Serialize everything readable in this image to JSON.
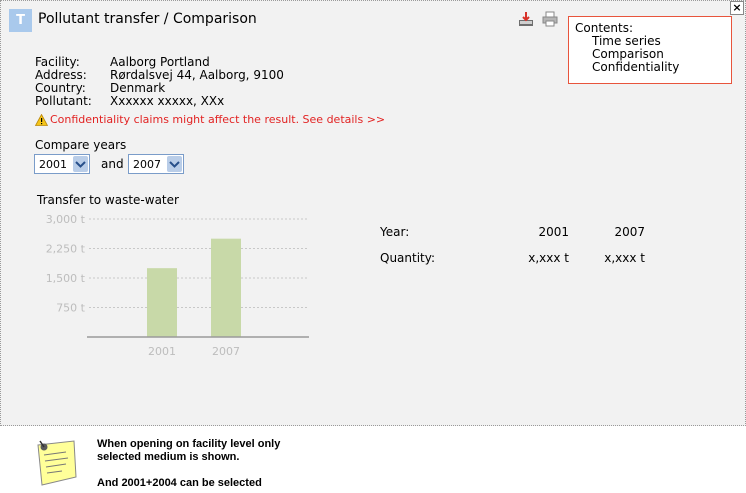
{
  "panel": {
    "badge": "T",
    "title": "Pollutant transfer / Comparison",
    "close_label": "×"
  },
  "contents": {
    "heading": "Contents:",
    "links": [
      "Time series",
      "Comparison",
      "Confidentiality"
    ]
  },
  "facility": {
    "facility_label": "Facility:",
    "facility_value": "Aalborg Portland",
    "address_label": "Address:",
    "address_value": "Rørdalsvej 44, Aalborg, 9100",
    "country_label": "Country:",
    "country_value": "Denmark",
    "pollutant_label": "Pollutant:",
    "pollutant_value": "Xxxxxx xxxxx, XXx"
  },
  "warning": "Confidentiality claims might affect the result. See details >>",
  "compare": {
    "label": "Compare years",
    "year1": "2001",
    "and_label": "and",
    "year2": "2007"
  },
  "chart_title": "Transfer to waste-water",
  "chart_data": {
    "type": "bar",
    "categories": [
      "2001",
      "2007"
    ],
    "values": [
      1750,
      2500
    ],
    "ylim": [
      0,
      3000
    ],
    "yticks": [
      750,
      1500,
      2250,
      3000
    ],
    "ytick_labels": [
      "750 t",
      "1,500 t",
      "2,250 t",
      "3,000 t"
    ],
    "grid": true,
    "bar_color": "#c8d9a8"
  },
  "info": {
    "year_label": "Year:",
    "year1": "2001",
    "year2": "2007",
    "quantity_label": "Quantity:",
    "q1": "x,xxx t",
    "q2": "x,xxx t"
  },
  "note": {
    "line1": "When opening on facility level only",
    "line2": "selected medium is shown.",
    "line3": "And 2001+2004 can be selected"
  },
  "colors": {
    "warning": "#e22323",
    "contents_border": "#e8543c",
    "badge": "#a9c9ec"
  }
}
